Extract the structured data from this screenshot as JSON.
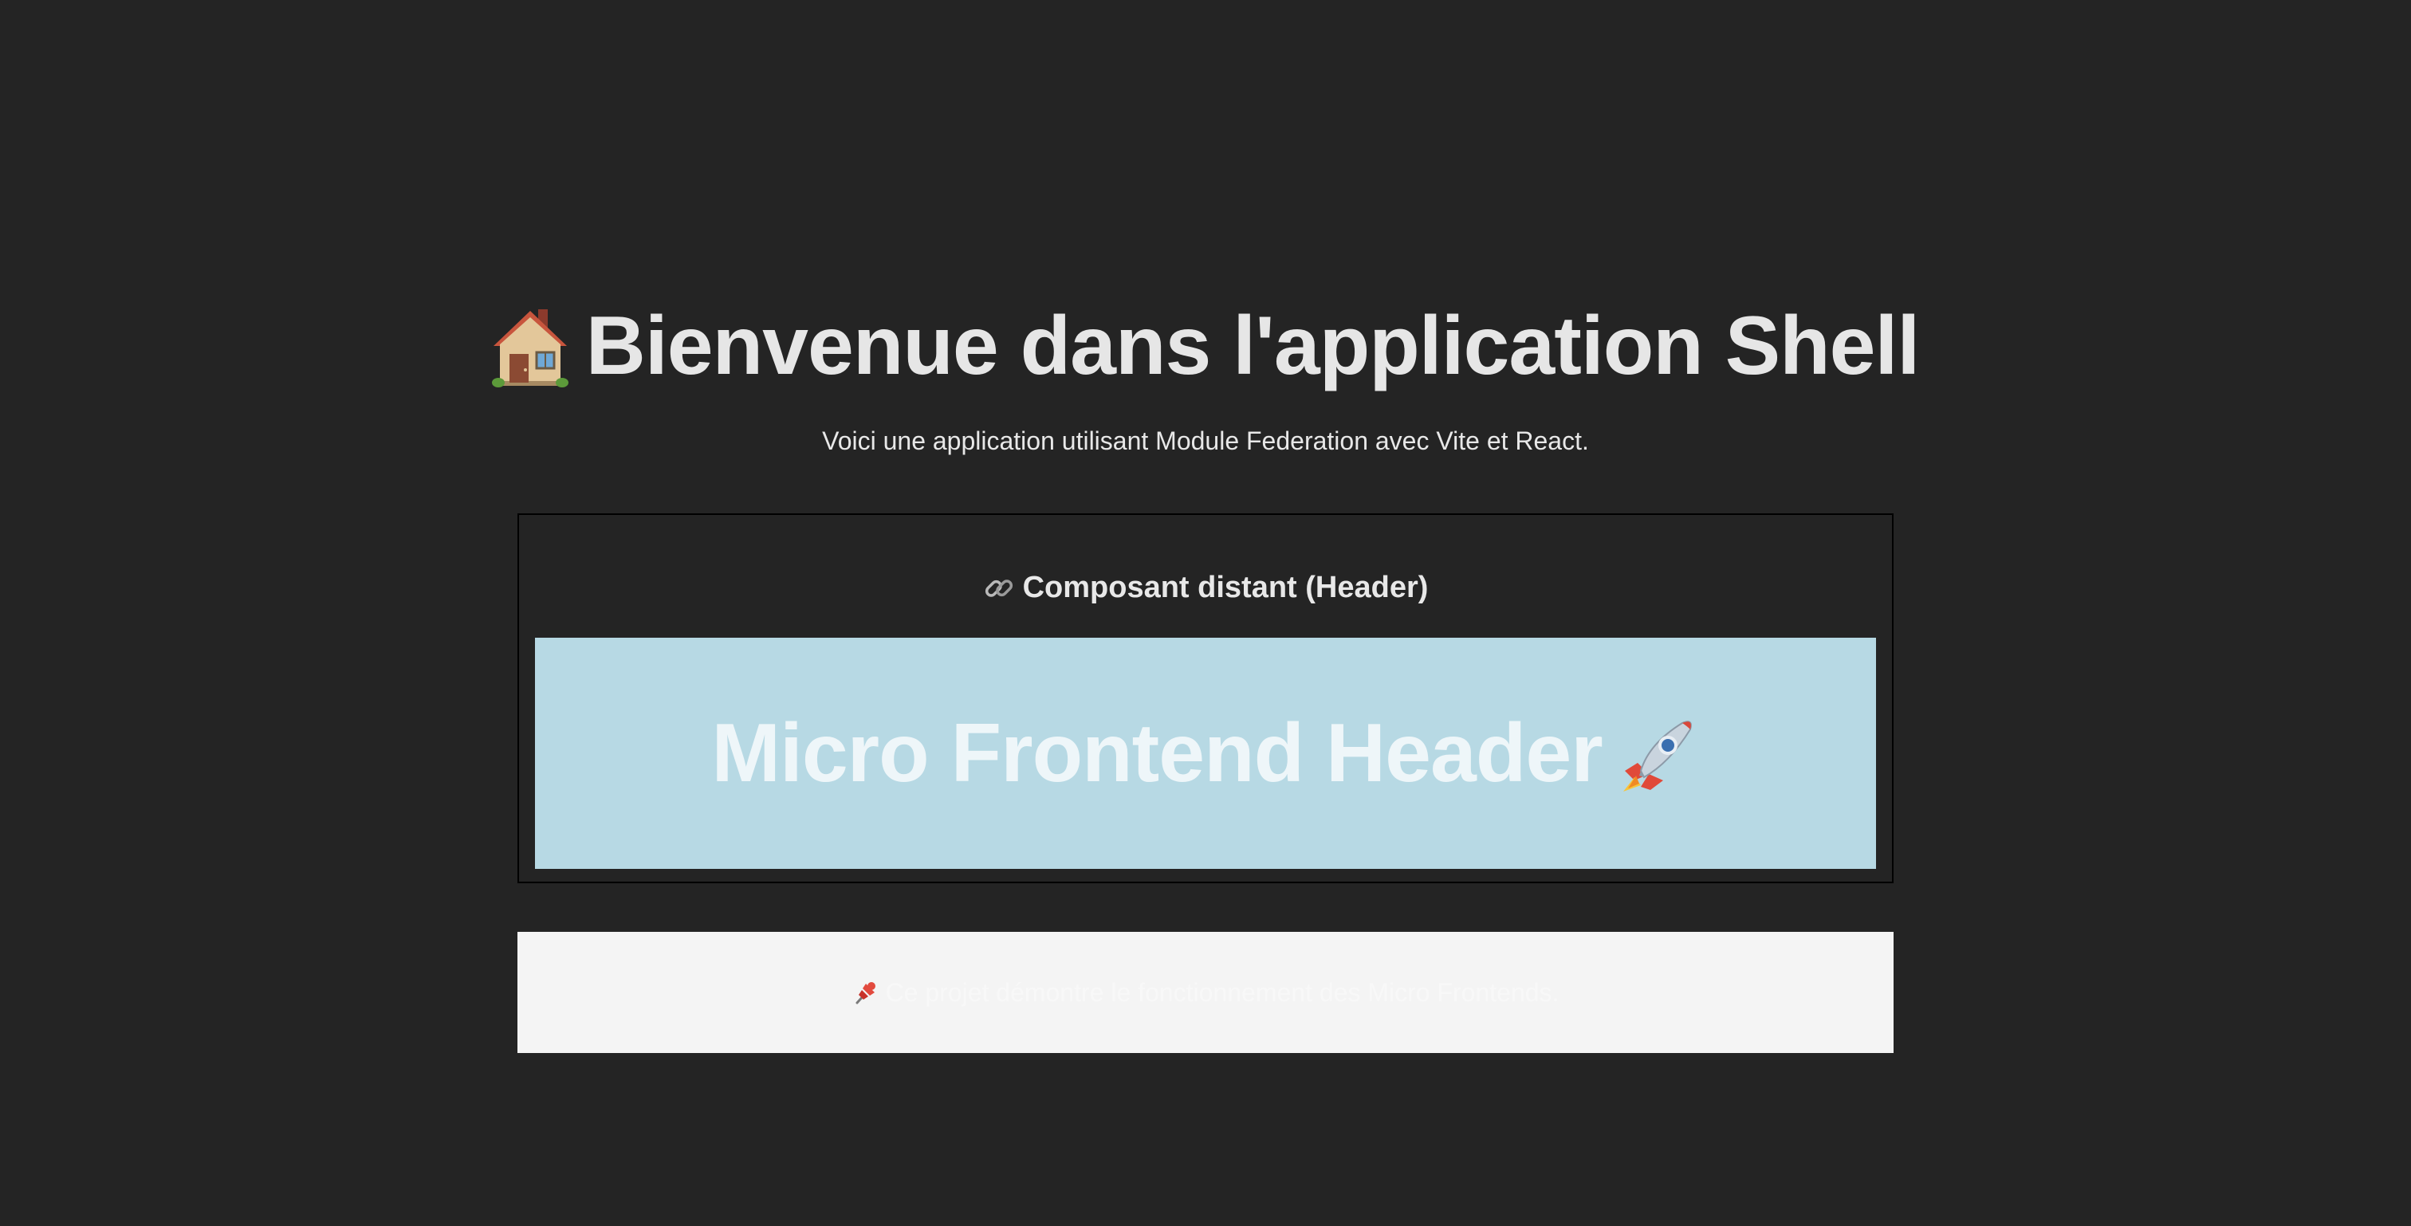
{
  "page": {
    "title": "Bienvenue dans l'application Shell",
    "title_icon": "house-icon",
    "subtitle": "Voici une application utilisant Module Federation avec Vite et React."
  },
  "remote": {
    "section_title": "Composant distant (Header)",
    "section_icon": "link-icon",
    "header_title": "Micro Frontend Header",
    "header_icon": "rocket-icon",
    "header_background": "#b7d9e4"
  },
  "footer": {
    "text": "Ce projet démontre le fonctionnement des Micro Frontends.",
    "icon": "pushpin-icon",
    "background": "#f4f4f4"
  },
  "colors": {
    "page_background": "#242424",
    "text": "#e6e6e6"
  }
}
